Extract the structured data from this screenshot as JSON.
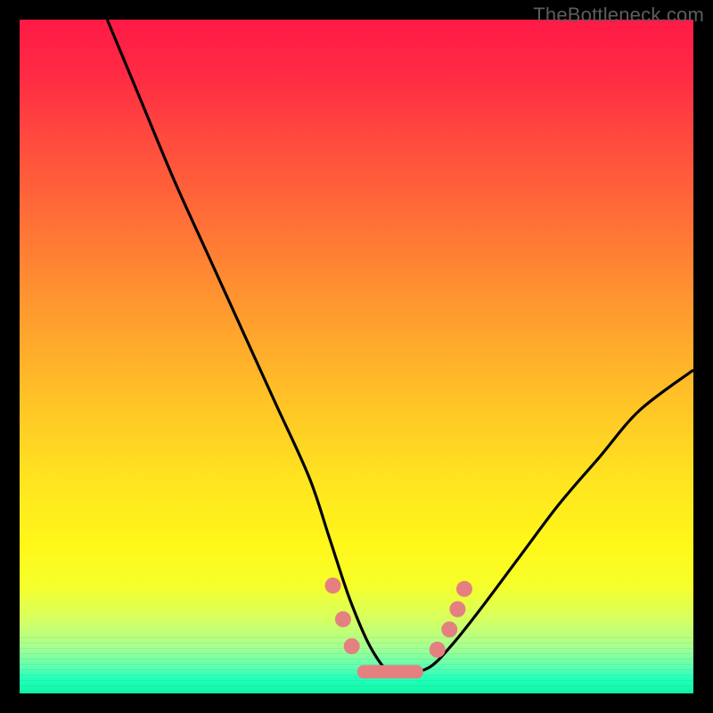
{
  "watermark": "TheBottleneck.com",
  "colors": {
    "background_black": "#000000",
    "gradient_top": "#ff1a46",
    "gradient_bottom": "#13f6a8",
    "curve_stroke": "#000000",
    "marker_fill": "#e58080"
  },
  "chart_data": {
    "type": "line",
    "title": "",
    "xlabel": "",
    "ylabel": "",
    "xlim": [
      0,
      100
    ],
    "ylim": [
      0,
      100
    ],
    "grid": false,
    "notes": "Background vertical gradient from red (high bottleneck) at top to green (balanced) at bottom. Single black curve roughly V-shaped with minimum near x≈55 at y≈3, left branch reaching y=100 at x≈13, right branch reaching y≈48 at x=100. Salmon markers cluster around the minimum and on both flanks near y≈9–16.",
    "series": [
      {
        "name": "bottleneck-curve",
        "x": [
          13,
          18,
          23,
          28,
          33,
          38,
          43,
          46,
          49,
          52,
          55,
          58,
          61,
          64,
          68,
          74,
          80,
          86,
          92,
          100
        ],
        "y": [
          100,
          88,
          76,
          65,
          54,
          43,
          32,
          23,
          14,
          7,
          3,
          3,
          4,
          7,
          12,
          20,
          28,
          35,
          42,
          48
        ]
      }
    ],
    "markers": [
      {
        "x": 46.5,
        "y": 16,
        "shape": "round"
      },
      {
        "x": 48.0,
        "y": 11,
        "shape": "round"
      },
      {
        "x": 49.3,
        "y": 7,
        "shape": "round"
      },
      {
        "x": 55.0,
        "y": 3.2,
        "shape": "pill"
      },
      {
        "x": 62.0,
        "y": 6.5,
        "shape": "round"
      },
      {
        "x": 63.8,
        "y": 9.5,
        "shape": "round"
      },
      {
        "x": 65.0,
        "y": 12.5,
        "shape": "round"
      },
      {
        "x": 66.0,
        "y": 15.5,
        "shape": "round"
      }
    ]
  }
}
